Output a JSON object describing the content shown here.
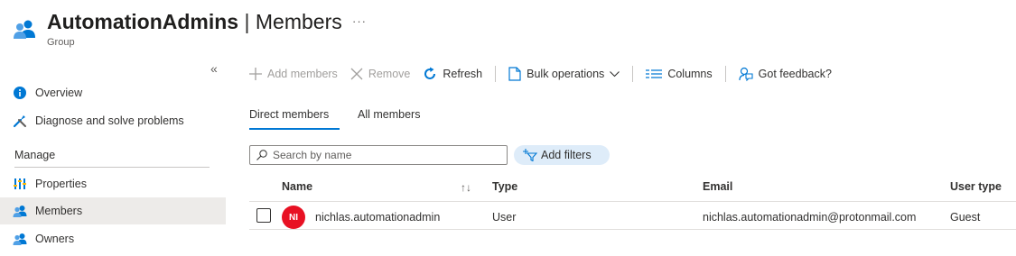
{
  "header": {
    "group_name": "AutomationAdmins",
    "separator": "|",
    "section": "Members",
    "more": "···",
    "subtitle": "Group"
  },
  "sidebar": {
    "collapse": "«",
    "items": [
      {
        "label": "Overview",
        "icon": "info-icon"
      },
      {
        "label": "Diagnose and solve problems",
        "icon": "wrench-icon"
      }
    ],
    "manage_header": "Manage",
    "manage_items": [
      {
        "label": "Properties",
        "icon": "properties-icon",
        "selected": false
      },
      {
        "label": "Members",
        "icon": "members-icon",
        "selected": true
      },
      {
        "label": "Owners",
        "icon": "owners-icon",
        "selected": false
      }
    ]
  },
  "toolbar": {
    "add_members": "Add members",
    "remove": "Remove",
    "refresh": "Refresh",
    "bulk_operations": "Bulk operations",
    "columns": "Columns",
    "feedback": "Got feedback?"
  },
  "tabs": {
    "direct": "Direct members",
    "all": "All members",
    "active": "direct"
  },
  "search": {
    "placeholder": "Search by name",
    "value": ""
  },
  "filters": {
    "label": "Add filters"
  },
  "table": {
    "columns": [
      "Name",
      "Type",
      "Email",
      "User type"
    ],
    "rows": [
      {
        "initials": "NI",
        "name": "nichlas.automationadmin",
        "type": "User",
        "email": "nichlas.automationadmin@protonmail.com",
        "user_type": "Guest"
      }
    ]
  },
  "colors": {
    "accent": "#0078d4",
    "avatar": "#e81123",
    "selected_nav": "#edebe9",
    "filter_pill": "#deecf9"
  }
}
